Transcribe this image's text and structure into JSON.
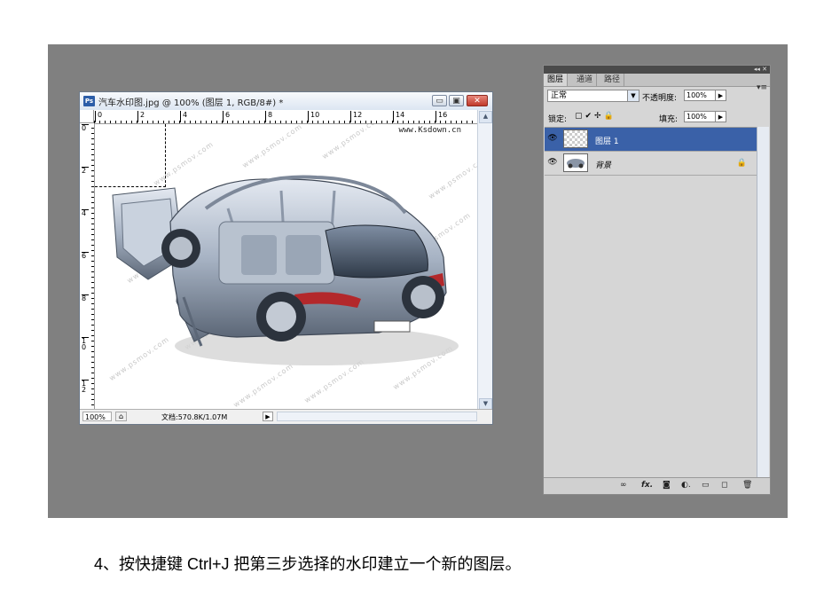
{
  "document": {
    "title": "汽车水印图.jpg @ 100% (图层 1, RGB/8#) *",
    "app_icon_label": "Ps",
    "minimize_label": "▭",
    "restore_label": "▣",
    "close_label": "✕",
    "ruler_h": [
      "0",
      "2",
      "4",
      "6",
      "8",
      "10",
      "12",
      "14",
      "16"
    ],
    "ruler_v": [
      "0",
      "2",
      "4",
      "6",
      "8",
      "10",
      "12"
    ],
    "site_watermark": "www.Ksdown.cn",
    "watermark_text": "www.psmov.com",
    "status": {
      "zoom": "100%",
      "doc_info": "文档:570.8K/1.07M",
      "arrow": "▶"
    }
  },
  "layers_panel": {
    "tabs": [
      "图层",
      "通道",
      "路径"
    ],
    "active_tab": 0,
    "top_controls": "◂◂ ✕",
    "menu_icon": "▾≡",
    "blend_mode": "正常",
    "opacity_label": "不透明度:",
    "opacity_value": "100%",
    "lock_label": "锁定:",
    "lock_icons": "▢✔✢🔒",
    "fill_label": "填充:",
    "fill_value": "100%",
    "layers": [
      {
        "name": "图层 1",
        "selected": true,
        "thumb": "transparent",
        "locked": false
      },
      {
        "name": "背景",
        "selected": false,
        "thumb": "car",
        "locked": true
      }
    ],
    "bottom_icons": [
      "link-icon",
      "fx-icon",
      "mask-icon",
      "adjustment-icon",
      "group-icon",
      "new-layer-icon",
      "trash-icon"
    ]
  },
  "caption": "4、按快捷键 Ctrl+J 把第三步选择的水印建立一个新的图层。",
  "colors": {
    "workspace": "#808080",
    "selected_layer": "#3a61a8",
    "panel_bg": "#d6d6d6"
  }
}
